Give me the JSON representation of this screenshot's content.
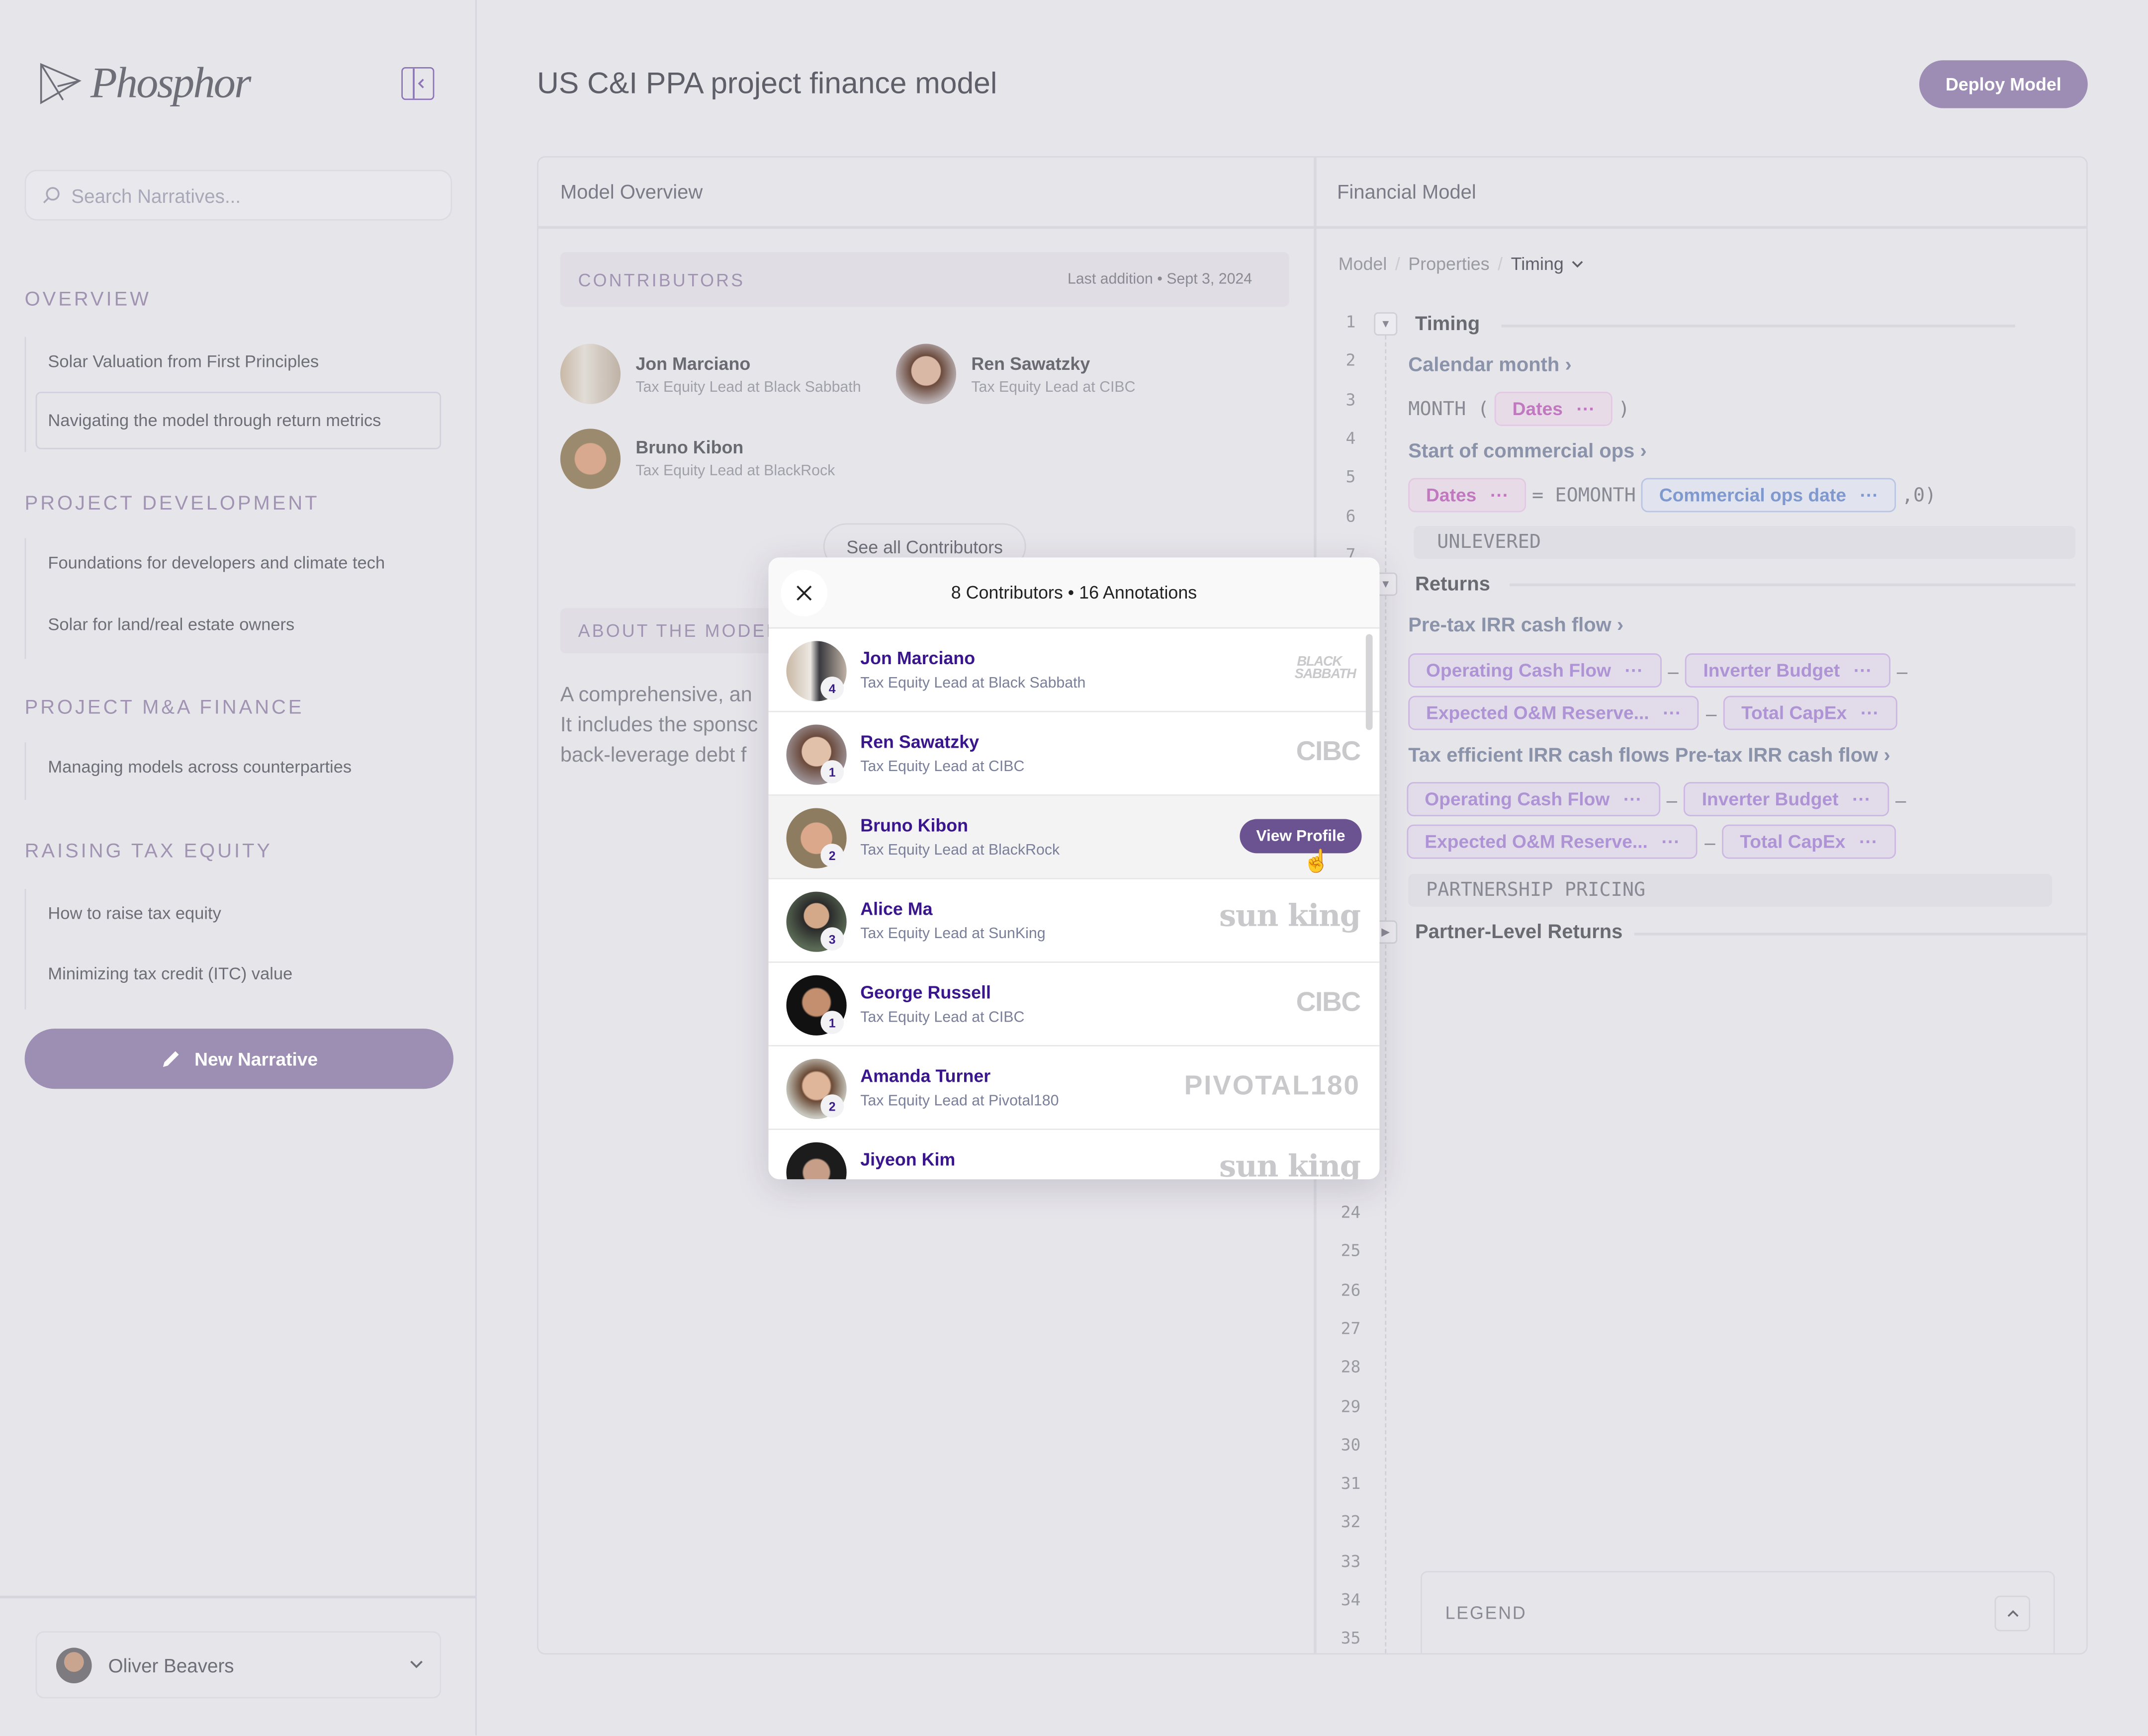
{
  "app": {
    "brand": "Phosphor"
  },
  "sidebar": {
    "search_placeholder": "Search Narratives...",
    "sections": [
      {
        "title": "OVERVIEW",
        "items": [
          "Solar Valuation from First Principles",
          "Navigating the model through return metrics"
        ]
      },
      {
        "title": "PROJECT DEVELOPMENT",
        "items": [
          "Foundations for developers and climate tech",
          "Solar for land/real estate owners"
        ]
      },
      {
        "title": "PROJECT M&A FINANCE",
        "items": [
          "Managing models across counterparties"
        ]
      },
      {
        "title": "RAISING TAX EQUITY",
        "items": [
          "How to raise tax equity",
          "Minimizing tax credit  (ITC) value"
        ]
      }
    ],
    "active_item": "Navigating the model through return metrics",
    "new_narrative": "New Narrative",
    "user": "Oliver Beavers"
  },
  "header": {
    "title": "US C&I PPA project finance model",
    "deploy": "Deploy Model"
  },
  "overview": {
    "title": "Model Overview",
    "contributors_label": "CONTRIBUTORS",
    "last_addition": "Last addition • Sept 3, 2024",
    "contributors": [
      {
        "name": "Jon Marciano",
        "role": "Tax Equity Lead at Black Sabbath"
      },
      {
        "name": "Ren Sawatzky",
        "role": "Tax Equity Lead at CIBC"
      },
      {
        "name": "Bruno Kibon",
        "role": "Tax Equity Lead at BlackRock"
      }
    ],
    "see_all": "See all Contributors",
    "about_label": "ABOUT THE MODEL",
    "about_lines": [
      "A comprehensive, an",
      "It includes the sponsc",
      "back-leverage debt f"
    ]
  },
  "financial": {
    "title": "Financial Model",
    "breadcrumb": [
      "Model",
      "Properties",
      "Timing"
    ],
    "line_numbers_top": [
      "1",
      "2",
      "3",
      "4",
      "5",
      "6",
      "7"
    ],
    "line_numbers_bottom": [
      "24",
      "25",
      "26",
      "27",
      "28",
      "29",
      "30",
      "31",
      "32",
      "33",
      "34",
      "35"
    ],
    "timing": "Timing",
    "calendar_month": "Calendar month",
    "month_fn": "MONTH (",
    "close_paren": ")",
    "dates": "Dates",
    "start_ops": "Start of commercial ops",
    "eomonth": "= EOMONTH",
    "commercial_ops_date": "Commercial ops date",
    "eomonth_tail": ",0)",
    "unlevered": "UNLEVERED",
    "returns": "Returns",
    "pretax": "Pre-tax IRR cash flow",
    "chips1": [
      "Operating Cash Flow",
      "Inverter Budget",
      "Expected O&M Reserve...",
      "Total CapEx"
    ],
    "tax_efficient": "Tax efficient IRR cash flows Pre-tax IRR cash flow",
    "partnership": "PARTNERSHIP PRICING",
    "partner_returns": "Partner-Level Returns",
    "legend": "LEGEND",
    "minus": "–",
    "dots": "···"
  },
  "popup": {
    "title": "8 Contributors • 16 Annotations",
    "view_profile": "View Profile",
    "rows": [
      {
        "name": "Jon Marciano",
        "role": "Tax Equity Lead at Black Sabbath",
        "count": "4",
        "logo": "BLACK SABBATH"
      },
      {
        "name": "Ren Sawatzky",
        "role": "Tax Equity Lead at CIBC",
        "count": "1",
        "logo": "CIBC"
      },
      {
        "name": "Bruno Kibon",
        "role": "Tax Equity Lead at BlackRock",
        "count": "2",
        "logo": ""
      },
      {
        "name": "Alice Ma",
        "role": "Tax Equity Lead at SunKing",
        "count": "3",
        "logo": "sun king"
      },
      {
        "name": "George Russell",
        "role": "Tax Equity Lead at CIBC",
        "count": "1",
        "logo": "CIBC"
      },
      {
        "name": "Amanda Turner",
        "role": "Tax Equity Lead at Pivotal180",
        "count": "2",
        "logo": "PIVOTAL180"
      },
      {
        "name": "Jiyeon Kim",
        "role": "",
        "count": "",
        "logo": "sun king"
      }
    ]
  },
  "colors": {
    "accent": "#6b5391",
    "link": "#3a168c",
    "muted_button": "#9d8fb3"
  }
}
